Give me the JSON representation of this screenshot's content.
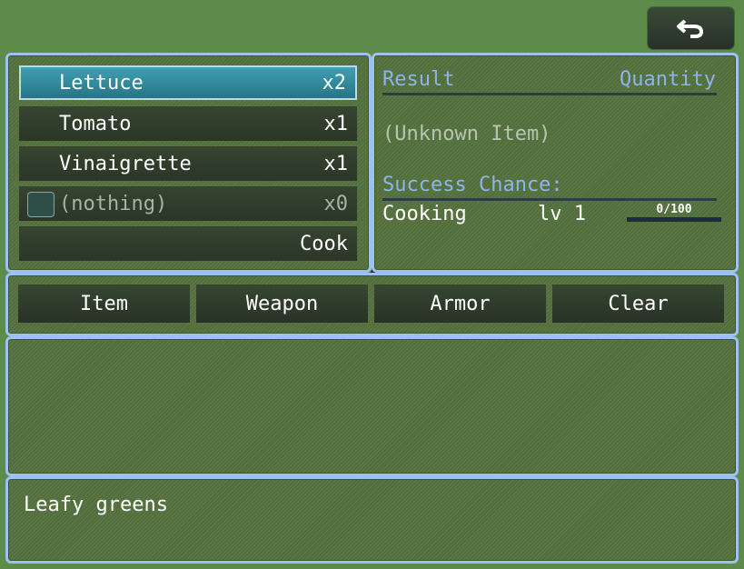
{
  "back_button": {
    "icon": "return-arrow-icon"
  },
  "ingredients": {
    "items": [
      {
        "name": "Lettuce",
        "qty": "x2"
      },
      {
        "name": "Tomato",
        "qty": "x1"
      },
      {
        "name": "Vinaigrette",
        "qty": "x1"
      },
      {
        "name": "(nothing)",
        "qty": "x0"
      }
    ],
    "cook_label": "Cook"
  },
  "result": {
    "result_header": "Result",
    "quantity_header": "Quantity",
    "item_name": "(Unknown Item)",
    "success_label": "Success Chance:",
    "skill_name": "Cooking",
    "skill_level": "lv 1",
    "exp_text": "0/100",
    "exp_progress": 0
  },
  "categories": [
    "Item",
    "Weapon",
    "Armor",
    "Clear"
  ],
  "help": {
    "text": "Leafy greens"
  },
  "colors": {
    "window_border": "#9ec2f0",
    "selected_row": "#2f8a9a",
    "header_text": "#8cb4ec"
  }
}
